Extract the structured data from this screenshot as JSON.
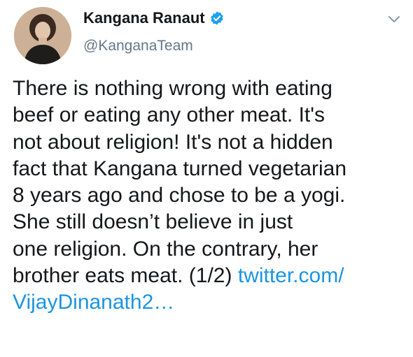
{
  "author": {
    "display_name": "Kangana Ranaut",
    "handle": "@KanganaTeam",
    "verified_icon": "verified-badge-icon",
    "avatar_icon": "profile-photo"
  },
  "menu": {
    "icon": "chevron-down-icon"
  },
  "tweet": {
    "lines": [
      "There is nothing wrong with eating",
      "beef or eating any other meat. It's",
      "not about religion! It's not a hidden",
      "fact that Kangana turned vegetarian",
      "8 years ago and chose to be a yogi.",
      "She still doesn’t believe in just",
      "one religion. On the contrary, her",
      "brother eats meat. (1/2)"
    ],
    "link_part1": "twitter.com/",
    "link_part2": "VijayDinanath2…"
  },
  "colors": {
    "text": "#14171a",
    "secondary": "#657786",
    "link": "#1b95e0",
    "verified": "#1da1f2",
    "background": "#ffffff"
  }
}
